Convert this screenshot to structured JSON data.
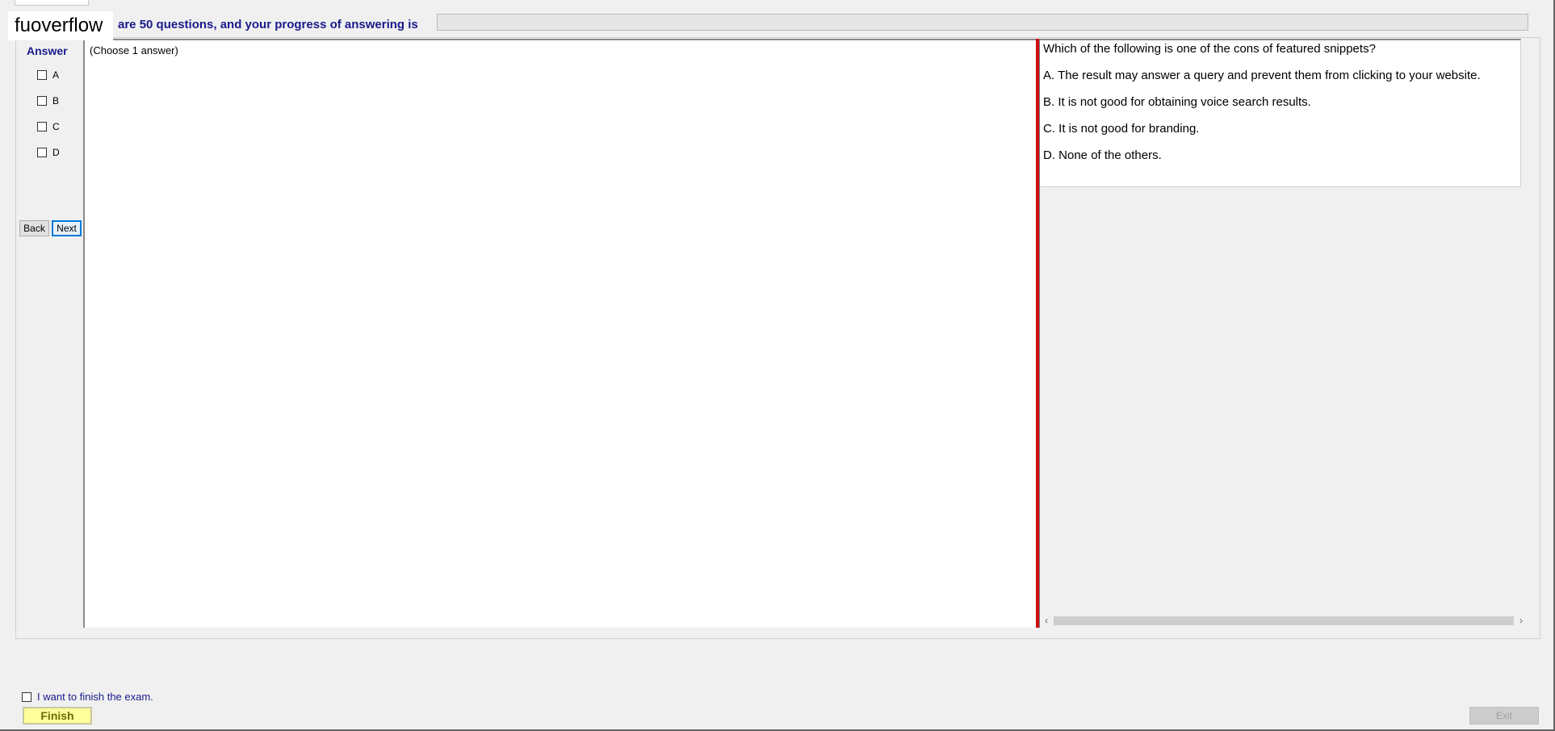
{
  "header": {
    "watermark": "fuoverflow",
    "info_text": "are 50 questions, and your progress of answering is",
    "progress_percent": 0
  },
  "answer_panel": {
    "title": "Answer",
    "options": [
      "A",
      "B",
      "C",
      "D"
    ],
    "back_label": "Back",
    "next_label": "Next"
  },
  "center": {
    "instruction": "(Choose 1 answer)"
  },
  "question": {
    "text": "Which of the following is one of the cons of featured snippets?",
    "choices": [
      "A.  The result may answer a query and prevent them from clicking to your website.",
      "B.  It is not good for obtaining voice search results.",
      "C.  It is not good for branding.",
      "D.  None of the others."
    ]
  },
  "scrollbar": {
    "left_arrow": "‹",
    "right_arrow": "›"
  },
  "footer": {
    "finish_checkbox_label": "I want to finish the exam.",
    "finish_label": "Finish",
    "exit_label": "Exit"
  },
  "colors": {
    "accent_text": "#1a1a8c",
    "divider_red": "#cc1010",
    "finish_bg": "#ffff9c"
  }
}
